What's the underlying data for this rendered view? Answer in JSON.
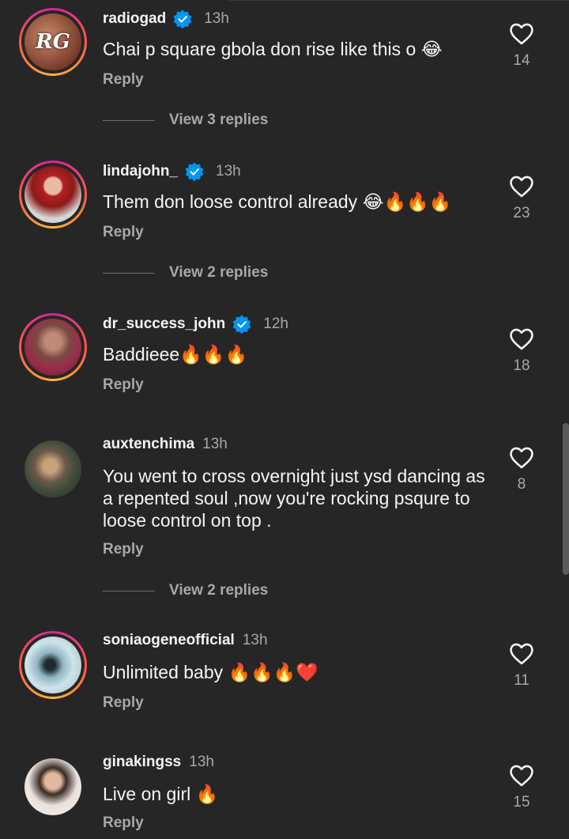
{
  "comments": [
    {
      "username": "radiogad",
      "verified": true,
      "time": "13h",
      "text": "Chai p square gbola don rise like this o 😂",
      "reply": "Reply",
      "likes": "14",
      "view_replies": "View 3 replies",
      "avatar_label": "RG",
      "story_ring": true
    },
    {
      "username": "lindajohn_",
      "verified": true,
      "time": "13h",
      "text": "Them don loose control already 😂🔥🔥🔥",
      "reply": "Reply",
      "likes": "23",
      "view_replies": "View 2 replies",
      "story_ring": true
    },
    {
      "username": "dr_success_john",
      "verified": true,
      "time": "12h",
      "text": "Baddieee🔥🔥🔥",
      "reply": "Reply",
      "likes": "18",
      "story_ring": true
    },
    {
      "username": "auxtenchima",
      "verified": false,
      "time": "13h",
      "text": "You went to cross overnight just ysd dancing as a repented soul ,now you're rocking psqure to loose control on top .",
      "reply": "Reply",
      "likes": "8",
      "view_replies": "View 2 replies",
      "story_ring": false
    },
    {
      "username": "soniaogeneofficial",
      "verified": false,
      "time": "13h",
      "text": "Unlimited baby 🔥🔥🔥❤️",
      "reply": "Reply",
      "likes": "11",
      "story_ring": true
    },
    {
      "username": "ginakingss",
      "verified": false,
      "time": "13h",
      "text": "Live on girl 🔥",
      "reply": "Reply",
      "likes": "15",
      "story_ring": false
    }
  ],
  "colors": {
    "background": "#262626",
    "secondary_text": "#a8a8a8",
    "verified_blue": "#0095f6"
  },
  "icons": {
    "like": "heart-outline-icon",
    "verified": "verified-badge-icon"
  }
}
